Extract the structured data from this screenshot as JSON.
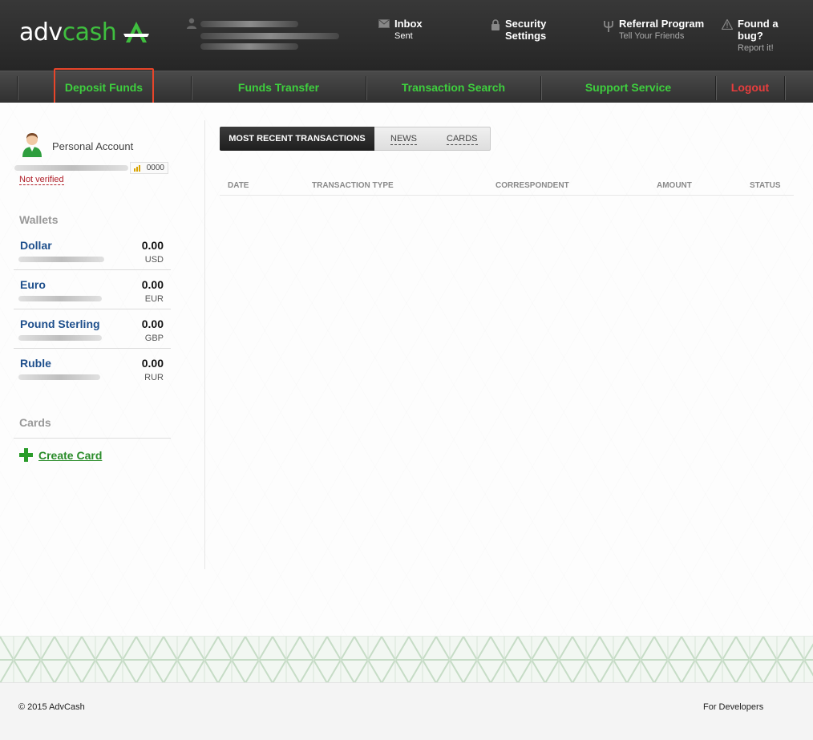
{
  "brand": {
    "name_part1": "adv",
    "name_part2": "cash",
    "accent_color": "#3fbf3f"
  },
  "header": {
    "inbox": {
      "title": "Inbox",
      "subtitle": "Sent",
      "icon": "envelope-icon"
    },
    "security": {
      "title_line1": "Security",
      "title_line2": "Settings",
      "icon": "lock-icon"
    },
    "referral": {
      "title": "Referral Program",
      "subtitle": "Tell Your Friends",
      "icon": "trident-icon"
    },
    "bug": {
      "title_line1": "Found a",
      "title_line2": "bug?",
      "subtitle": "Report it!",
      "icon": "warning-icon"
    }
  },
  "nav": {
    "items": [
      {
        "label": "Deposit Funds",
        "highlighted": true
      },
      {
        "label": "Funds Transfer"
      },
      {
        "label": "Transaction Search"
      },
      {
        "label": "Support Service"
      },
      {
        "label": "Logout",
        "color": "#e83d3d"
      }
    ]
  },
  "account": {
    "title": "Personal Account",
    "badge_value": "0000",
    "verification_status": "Not verified"
  },
  "wallets": {
    "title": "Wallets",
    "items": [
      {
        "name": "Dollar",
        "amount": "0.00",
        "currency": "USD"
      },
      {
        "name": "Euro",
        "amount": "0.00",
        "currency": "EUR"
      },
      {
        "name": "Pound Sterling",
        "amount": "0.00",
        "currency": "GBP"
      },
      {
        "name": "Ruble",
        "amount": "0.00",
        "currency": "RUR"
      }
    ]
  },
  "cards": {
    "title": "Cards",
    "create_label": "Create Card"
  },
  "tabs": {
    "active": "MOST RECENT TRANSACTIONS",
    "news": "NEWS",
    "cards": "CARDS"
  },
  "table": {
    "columns": [
      "DATE",
      "TRANSACTION TYPE",
      "CORRESPONDENT",
      "AMOUNT",
      "STATUS"
    ]
  },
  "footer": {
    "copyright": "© 2015 AdvCash",
    "developers": "For Developers"
  }
}
